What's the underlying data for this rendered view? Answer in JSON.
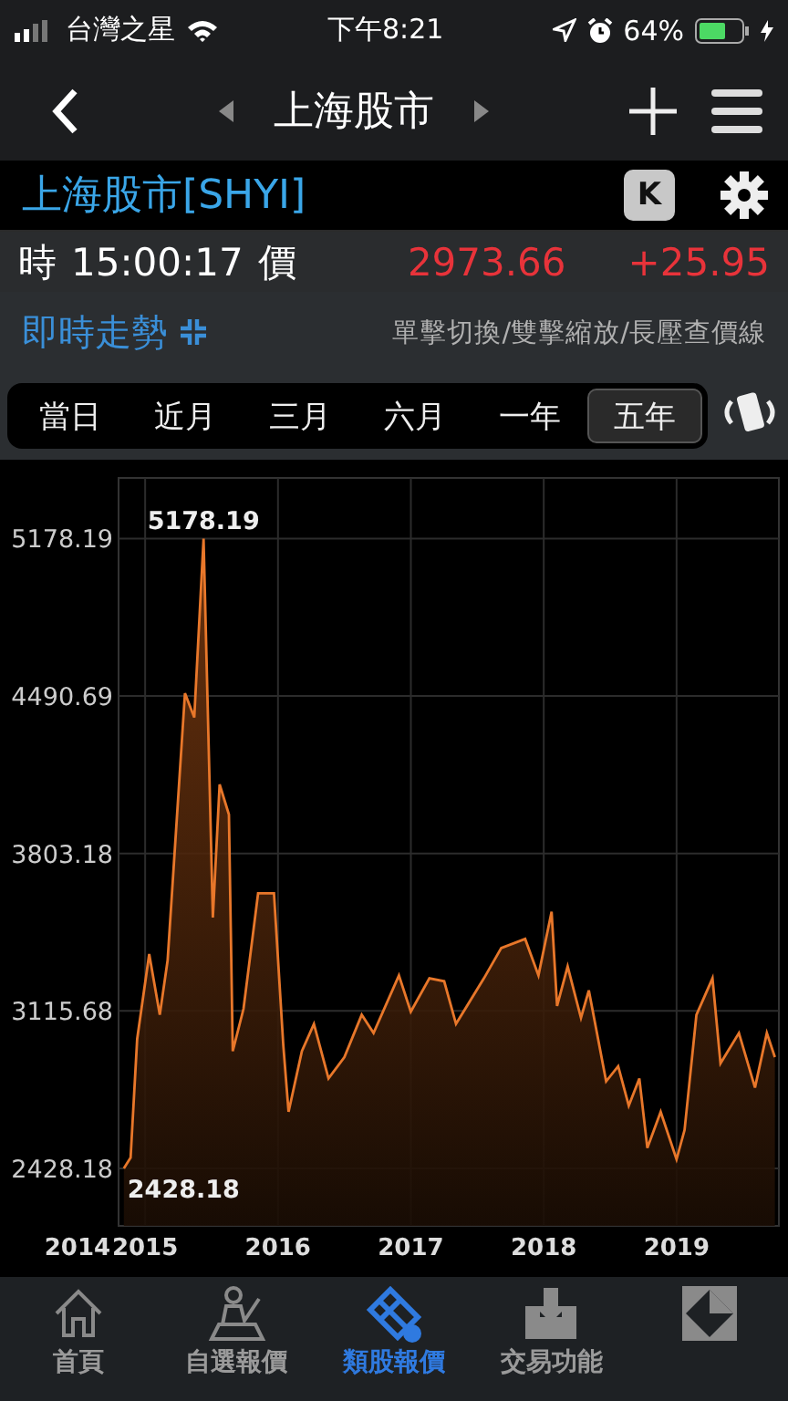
{
  "status_bar": {
    "carrier": "台灣之星",
    "time": "下午8:21",
    "battery": "64%"
  },
  "nav": {
    "title": "上海股市"
  },
  "quote": {
    "name": "上海股市[SHYI]",
    "k_button": "K",
    "time_label": "時",
    "time": "15:00:17",
    "price_label": "價",
    "price": "2973.66",
    "change": "+25.95"
  },
  "trend": {
    "title": "即時走勢",
    "hint": "單擊切換/雙擊縮放/長壓查價線"
  },
  "periods": [
    {
      "label": "當日",
      "selected": false
    },
    {
      "label": "近月",
      "selected": false
    },
    {
      "label": "三月",
      "selected": false
    },
    {
      "label": "六月",
      "selected": false
    },
    {
      "label": "一年",
      "selected": false
    },
    {
      "label": "五年",
      "selected": true
    }
  ],
  "chart_data": {
    "type": "area",
    "grid": true,
    "xlim": [
      2014.8,
      2019.77
    ],
    "ylim": [
      2177,
      5443
    ],
    "xticks": [
      2015,
      2016,
      2017,
      2018,
      2019
    ],
    "yticks": [
      2428.18,
      3115.68,
      3803.18,
      4490.69,
      5178.19
    ],
    "x": [
      2014.84,
      2014.89,
      2014.94,
      2015.03,
      2015.11,
      2015.17,
      2015.3,
      2015.37,
      2015.44,
      2015.51,
      2015.56,
      2015.63,
      2015.66,
      2015.74,
      2015.85,
      2015.97,
      2016.04,
      2016.08,
      2016.18,
      2016.27,
      2016.38,
      2016.5,
      2016.63,
      2016.72,
      2016.91,
      2017.0,
      2017.14,
      2017.25,
      2017.34,
      2017.55,
      2017.68,
      2017.86,
      2017.96,
      2018.06,
      2018.1,
      2018.18,
      2018.28,
      2018.34,
      2018.47,
      2018.56,
      2018.64,
      2018.72,
      2018.78,
      2018.88,
      2019.0,
      2019.06,
      2019.15,
      2019.27,
      2019.33,
      2019.47,
      2019.59,
      2019.68,
      2019.74
    ],
    "series": [
      {
        "color": "#e8772a",
        "values": [
          2428,
          2475,
          2993,
          3364,
          3099,
          3337,
          4503,
          4397,
          5178,
          3523,
          4105,
          3973,
          2940,
          3125,
          3629,
          3629,
          2967,
          2675,
          2940,
          3059,
          2821,
          2914,
          3099,
          3019,
          3271,
          3112,
          3258,
          3245,
          3059,
          3258,
          3390,
          3430,
          3271,
          3549,
          3138,
          3310,
          3085,
          3205,
          2808,
          2874,
          2702,
          2821,
          2517,
          2675,
          2468,
          2596,
          3099,
          3258,
          2887,
          3019,
          2781,
          3019,
          2914
        ]
      }
    ],
    "annotations": [
      {
        "x": 2015.44,
        "y": 5178.19,
        "text": "5178.19"
      },
      {
        "x": 2014.84,
        "y": 2428.18,
        "text": "2428.18"
      }
    ]
  },
  "chart_axis": {
    "first_label": "2014"
  },
  "tab_bar": [
    {
      "label": "首頁",
      "selected": false
    },
    {
      "label": "自選報價",
      "selected": false
    },
    {
      "label": "類股報價",
      "selected": true
    },
    {
      "label": "交易功能",
      "selected": false
    },
    {
      "selected": false
    }
  ]
}
